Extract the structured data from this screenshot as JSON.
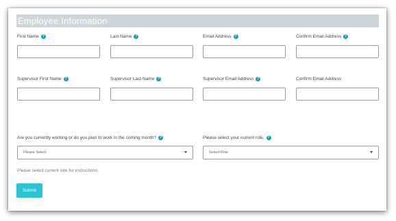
{
  "form": {
    "title": "Employee Information",
    "fields": {
      "first_name": "First Name",
      "last_name": "Last Name",
      "email": "Email Address",
      "confirm_email": "Confirm Email Address",
      "sup_first_name": "Supervisor First Name",
      "sup_last_name": "Supervisor Last Name",
      "sup_email": "Supervisor Email Address",
      "sup_confirm_email": "Confirm Email Address"
    },
    "help_glyph": "?",
    "working_question": "Are you currently working or do you plan to work in the coming month?",
    "working_select": "Please Select",
    "role_question": "Please select your current role.",
    "role_select": "Select Role",
    "note": "Please select current role for instructions.",
    "submit_label": "Submit"
  },
  "colors": {
    "accent": "#2cc4d3",
    "help_icon": "#1aa0b0",
    "header_bar": "#cfd6d9"
  }
}
